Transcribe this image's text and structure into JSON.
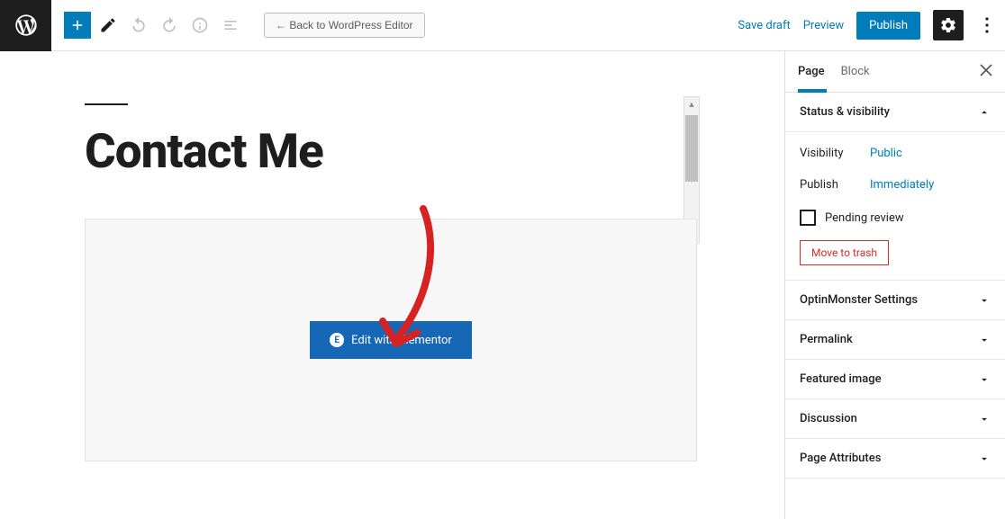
{
  "topbar": {
    "back_label": "← Back to WordPress Editor",
    "save_draft": "Save draft",
    "preview": "Preview",
    "publish": "Publish"
  },
  "page": {
    "title": "Contact Me",
    "elementor_button": "Edit with Elementor"
  },
  "sidebar": {
    "tabs": {
      "page": "Page",
      "block": "Block"
    },
    "status": {
      "heading": "Status & visibility",
      "visibility_label": "Visibility",
      "visibility_value": "Public",
      "publish_label": "Publish",
      "publish_value": "Immediately",
      "pending_review": "Pending review",
      "move_to_trash": "Move to trash"
    },
    "panels": {
      "optinmonster": "OptinMonster Settings",
      "permalink": "Permalink",
      "featured_image": "Featured image",
      "discussion": "Discussion",
      "page_attributes": "Page Attributes"
    }
  }
}
